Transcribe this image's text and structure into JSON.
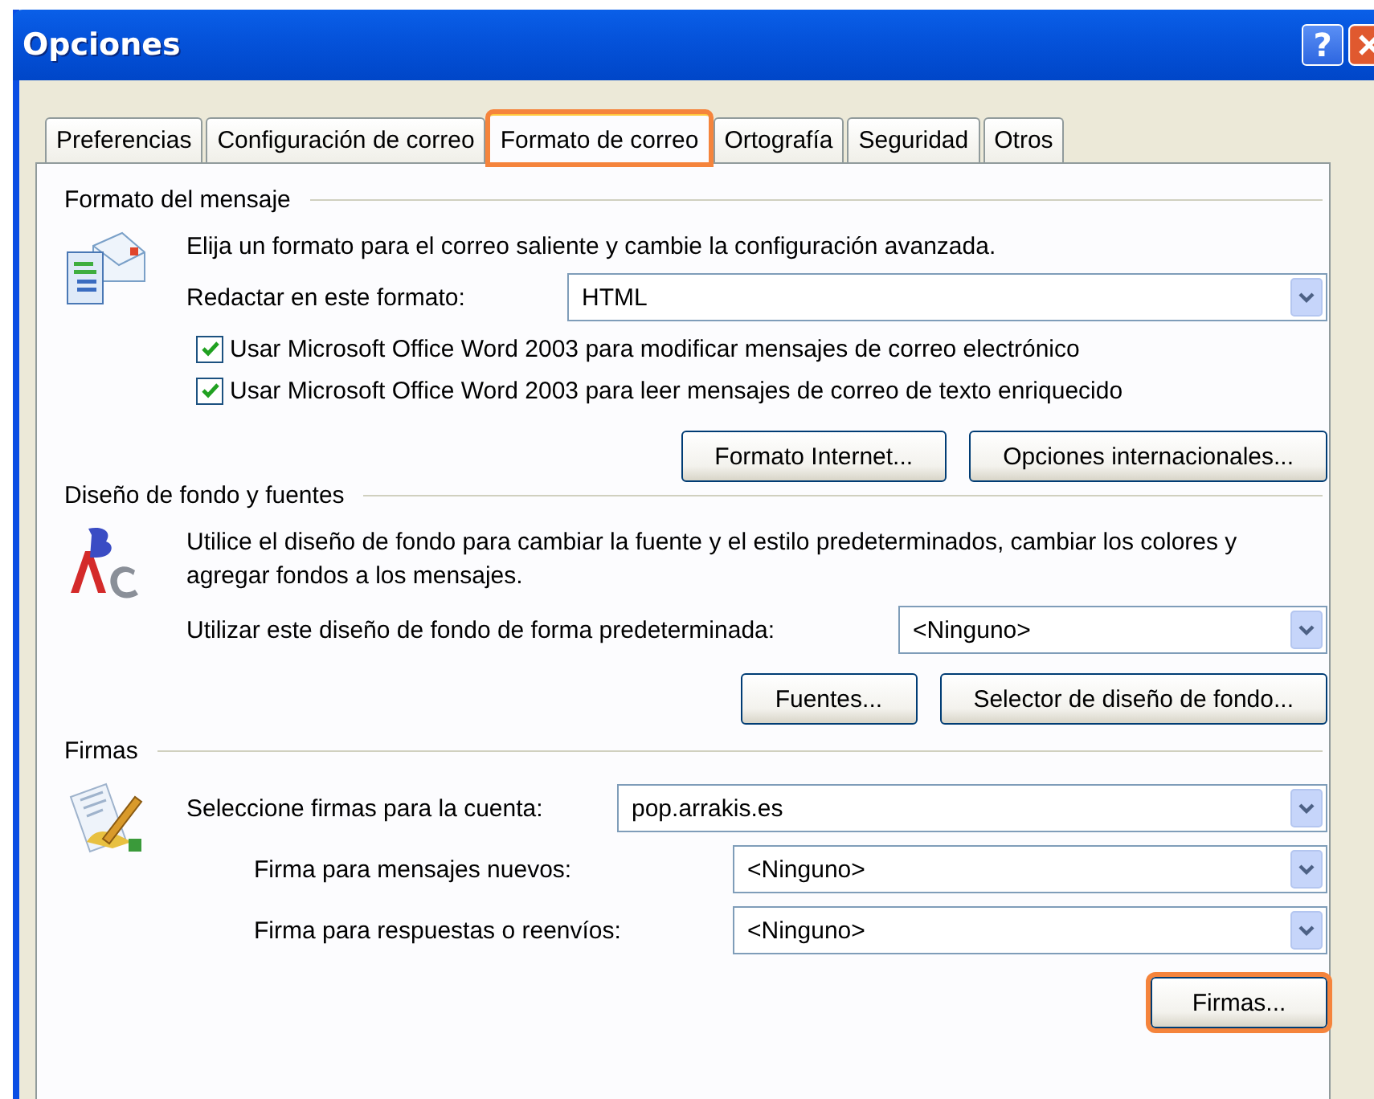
{
  "window": {
    "title": "Opciones",
    "help_button": "?"
  },
  "tabs": [
    {
      "label": "Preferencias",
      "selected": false,
      "highlighted": false
    },
    {
      "label": "Configuración de correo",
      "selected": false,
      "highlighted": false
    },
    {
      "label": "Formato de correo",
      "selected": true,
      "highlighted": true
    },
    {
      "label": "Ortografía",
      "selected": false,
      "highlighted": false
    },
    {
      "label": "Seguridad",
      "selected": false,
      "highlighted": false
    },
    {
      "label": "Otros",
      "selected": false,
      "highlighted": false
    }
  ],
  "message_format": {
    "heading": "Formato del mensaje",
    "description": "Elija un formato para el correo saliente y cambie la configuración avanzada.",
    "compose_label": "Redactar en este formato:",
    "compose_value": "HTML",
    "options": [
      {
        "label": "Usar Microsoft Office Word 2003 para modificar mensajes de correo electrónico",
        "checked": true
      },
      {
        "label": "Usar Microsoft Office Word 2003 para leer mensajes de correo de texto enriquecido",
        "checked": true
      }
    ],
    "buttons": [
      {
        "label": "Formato Internet...",
        "highlighted": false
      },
      {
        "label": "Opciones internacionales...",
        "highlighted": false
      }
    ]
  },
  "stationery": {
    "heading": "Diseño de fondo y fuentes",
    "description": "Utilice el diseño de fondo para cambiar la fuente y el estilo predeterminados, cambiar los colores y agregar fondos a los mensajes.",
    "default_label": "Utilizar este diseño de fondo de forma predeterminada:",
    "default_value": "<Ninguno>",
    "buttons": [
      {
        "label": "Fuentes...",
        "highlighted": false
      },
      {
        "label": "Selector de diseño de fondo...",
        "highlighted": false
      }
    ]
  },
  "signatures": {
    "heading": "Firmas",
    "account_label": "Seleccione firmas para la cuenta:",
    "account_value": "pop.arrakis.es",
    "rows": [
      {
        "label": "Firma para mensajes nuevos:",
        "value": "<Ninguno>"
      },
      {
        "label": "Firma para respuestas o reenvíos:",
        "value": "<Ninguno>"
      }
    ],
    "buttons": [
      {
        "label": "Firmas...",
        "highlighted": true
      }
    ]
  }
}
